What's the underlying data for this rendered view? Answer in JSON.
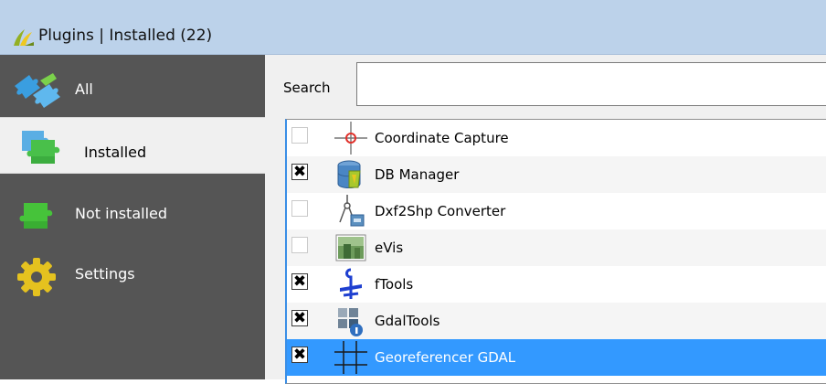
{
  "window": {
    "title": "Plugins | Installed (22)"
  },
  "sidebar": {
    "items": [
      {
        "label": "All",
        "icon": "puzzle-all-icon",
        "selected": false
      },
      {
        "label": "Installed",
        "icon": "puzzle-installed-icon",
        "selected": true
      },
      {
        "label": "Not installed",
        "icon": "puzzle-not-installed-icon",
        "selected": false
      },
      {
        "label": "Settings",
        "icon": "gear-icon",
        "selected": false
      }
    ]
  },
  "search": {
    "label": "Search",
    "value": ""
  },
  "plugins": [
    {
      "name": "Coordinate Capture",
      "checked": false,
      "icon": "crosshair-icon"
    },
    {
      "name": "DB Manager",
      "checked": true,
      "icon": "database-icon"
    },
    {
      "name": "Dxf2Shp Converter",
      "checked": false,
      "icon": "dxf-converter-icon"
    },
    {
      "name": "eVis",
      "checked": false,
      "icon": "photo-icon"
    },
    {
      "name": "fTools",
      "checked": true,
      "icon": "ftools-icon"
    },
    {
      "name": "GdalTools",
      "checked": true,
      "icon": "gdal-tools-icon"
    },
    {
      "name": "Georeferencer GDAL",
      "checked": true,
      "icon": "georeferencer-grid-icon",
      "selected": true
    }
  ],
  "colors": {
    "titlebar": "#bcd2ea",
    "sidebar": "#555555",
    "selection": "#3399ff"
  }
}
